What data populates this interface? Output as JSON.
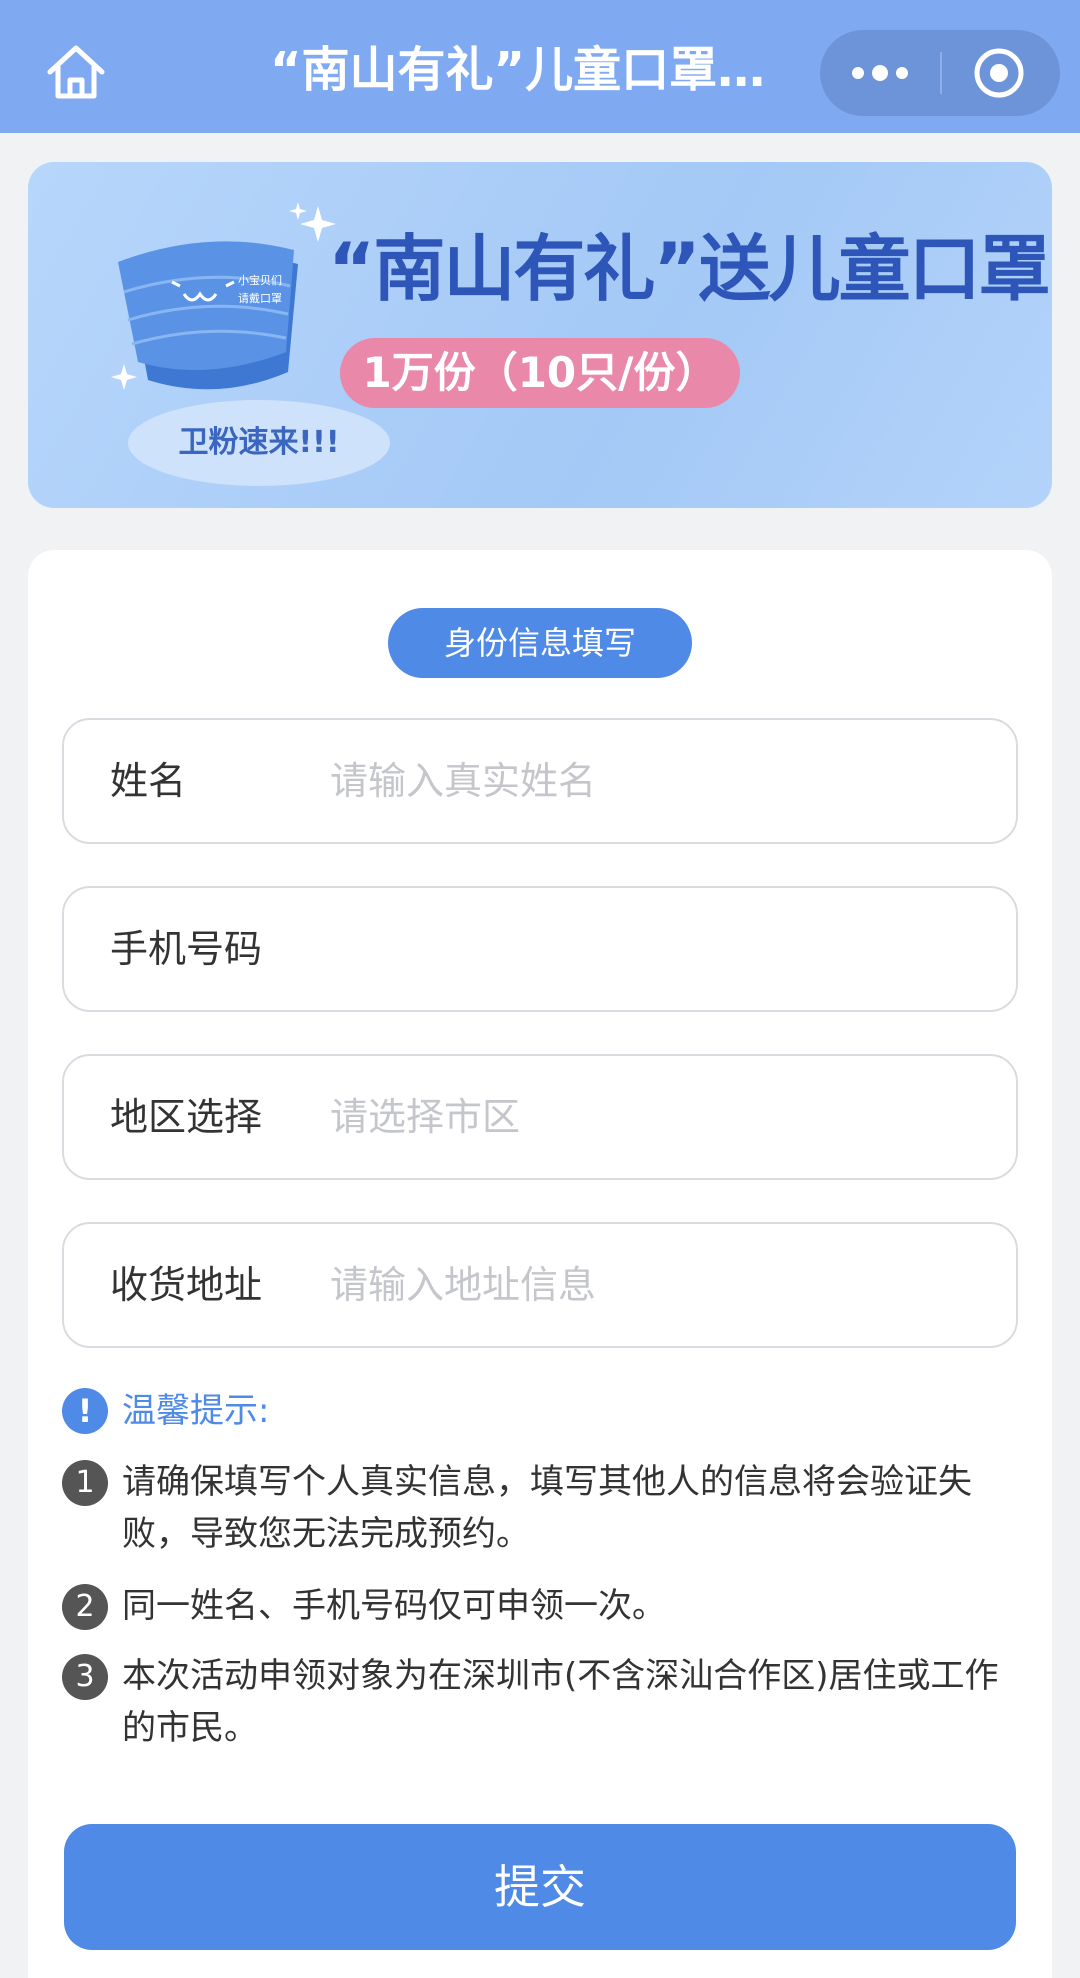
{
  "navbar": {
    "title": "“南山有礼”儿童口罩领取",
    "home_icon": "home-icon",
    "more_icon": "more-dots-icon",
    "target_icon": "target-circle-icon",
    "bg_color": "#7faaf2"
  },
  "banner": {
    "headline": "“南山有礼”送儿童口罩",
    "subline": "1万份（10只/份）",
    "bubble_text": "卫粉速来!!!",
    "mask_text_line1": "小宝贝们",
    "mask_text_line2": "请戴口罩"
  },
  "form": {
    "section_title": "身份信息填写",
    "fields": [
      {
        "label": "姓名",
        "placeholder": "请输入真实姓名",
        "value": ""
      },
      {
        "label": "手机号码",
        "placeholder": "",
        "value": ""
      },
      {
        "label": "地区选择",
        "placeholder": "请选择市区",
        "value": ""
      },
      {
        "label": "收货地址",
        "placeholder": "请输入地址信息",
        "value": ""
      }
    ]
  },
  "tips": {
    "title": "温馨提示:",
    "icon": "!",
    "items": [
      {
        "num": "1",
        "text": "请确保填写个人真实信息，填写其他人的信息将会验证失败，导致您无法完成预约。"
      },
      {
        "num": "2",
        "text": "同一姓名、手机号码仅可申领一次。"
      },
      {
        "num": "3",
        "text": "本次活动申领对象为在深圳市(不含深汕合作区)居住或工作的市民。"
      }
    ]
  },
  "submit_label": "提交",
  "colors": {
    "primary": "#4f8ae6",
    "pink": "#ea88a9"
  }
}
